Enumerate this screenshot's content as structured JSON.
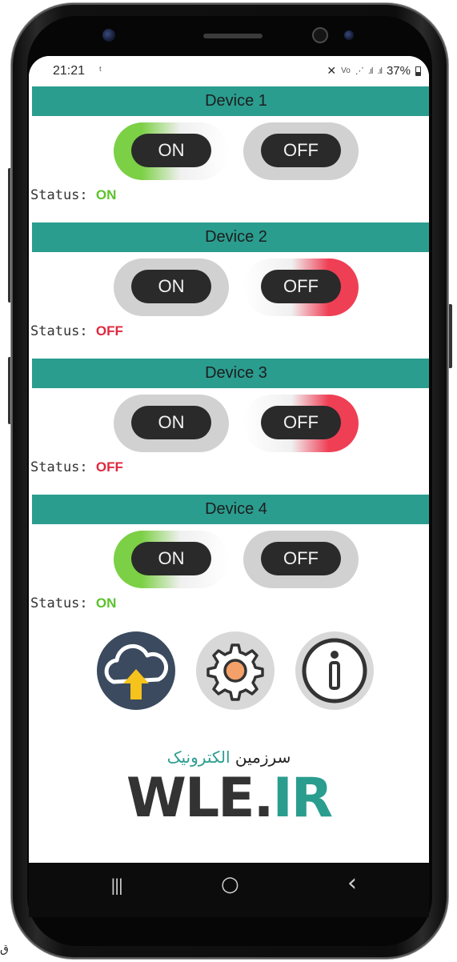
{
  "statusbar": {
    "time": "21:21",
    "battery": "37%",
    "icons": [
      "mute-icon",
      "volte-icon",
      "wifi-icon",
      "signal-icon",
      "signal-icon",
      "battery-icon"
    ]
  },
  "devices": [
    {
      "title": "Device 1",
      "on_label": "ON",
      "off_label": "OFF",
      "status_label": "Status:",
      "status_value": "ON",
      "active": "on"
    },
    {
      "title": "Device 2",
      "on_label": "ON",
      "off_label": "OFF",
      "status_label": "Status:",
      "status_value": "OFF",
      "active": "off"
    },
    {
      "title": "Device 3",
      "on_label": "ON",
      "off_label": "OFF",
      "status_label": "Status:",
      "status_value": "OFF",
      "active": "off"
    },
    {
      "title": "Device 4",
      "on_label": "ON",
      "off_label": "OFF",
      "status_label": "Status:",
      "status_value": "ON",
      "active": "on"
    }
  ],
  "actions": {
    "upload_icon": "cloud-upload-icon",
    "settings_icon": "gear-icon",
    "info_icon": "info-icon"
  },
  "brand": {
    "tagline_part1": "سرزمین",
    "tagline_part2": "الکترونیک",
    "logo_part1": "WLE.",
    "logo_part2": "IR"
  },
  "navbar": {
    "recent": "|||",
    "home": "○",
    "back": "‹"
  },
  "colors": {
    "teal": "#2a9d8f",
    "on_green": "#7bd045",
    "off_red": "#ef3f55",
    "status_on": "#5cc22c",
    "status_off": "#e0283f"
  },
  "stray_char": "ق"
}
